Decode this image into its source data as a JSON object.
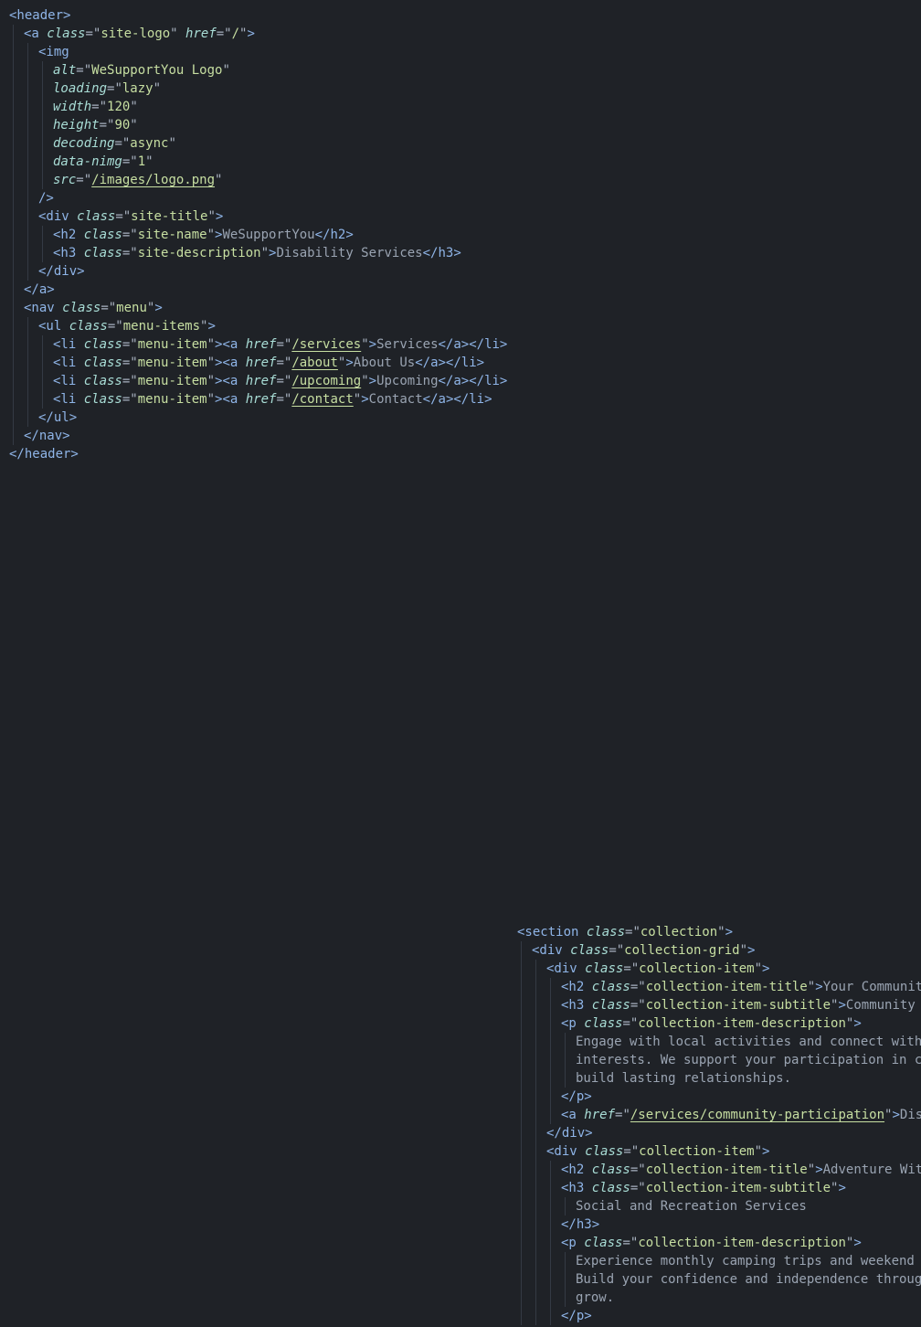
{
  "editor": {
    "theme_background": "#1f2227",
    "colors": {
      "tag": "#8fb5e8",
      "attribute": "#a9ddd6",
      "string": "#c7dfa2",
      "text": "#9aa4b2"
    }
  },
  "header_block": {
    "lines": [
      [
        {
          "k": "t",
          "v": "<header>"
        }
      ],
      [
        {
          "k": "t",
          "v": "<a "
        },
        {
          "k": "attr",
          "v": "class"
        },
        {
          "k": "eq",
          "v": "=\""
        },
        {
          "k": "str",
          "v": "site-logo"
        },
        {
          "k": "eq",
          "v": "\" "
        },
        {
          "k": "attr",
          "v": "href"
        },
        {
          "k": "eq",
          "v": "=\""
        },
        {
          "k": "str",
          "v": "/"
        },
        {
          "k": "eq",
          "v": "\""
        },
        {
          "k": "t",
          "v": ">"
        }
      ],
      [
        {
          "k": "t",
          "v": "<img"
        }
      ],
      [
        {
          "k": "attr",
          "v": "alt"
        },
        {
          "k": "eq",
          "v": "=\""
        },
        {
          "k": "str",
          "v": "WeSupportYou Logo"
        },
        {
          "k": "eq",
          "v": "\""
        }
      ],
      [
        {
          "k": "attr",
          "v": "loading"
        },
        {
          "k": "eq",
          "v": "=\""
        },
        {
          "k": "str",
          "v": "lazy"
        },
        {
          "k": "eq",
          "v": "\""
        }
      ],
      [
        {
          "k": "attr",
          "v": "width"
        },
        {
          "k": "eq",
          "v": "=\""
        },
        {
          "k": "str",
          "v": "120"
        },
        {
          "k": "eq",
          "v": "\""
        }
      ],
      [
        {
          "k": "attr",
          "v": "height"
        },
        {
          "k": "eq",
          "v": "=\""
        },
        {
          "k": "str",
          "v": "90"
        },
        {
          "k": "eq",
          "v": "\""
        }
      ],
      [
        {
          "k": "attr",
          "v": "decoding"
        },
        {
          "k": "eq",
          "v": "=\""
        },
        {
          "k": "str",
          "v": "async"
        },
        {
          "k": "eq",
          "v": "\""
        }
      ],
      [
        {
          "k": "attr",
          "v": "data-nimg"
        },
        {
          "k": "eq",
          "v": "=\""
        },
        {
          "k": "str",
          "v": "1"
        },
        {
          "k": "eq",
          "v": "\""
        }
      ],
      [
        {
          "k": "attr",
          "v": "src"
        },
        {
          "k": "eq",
          "v": "=\""
        },
        {
          "k": "link",
          "v": "/images/logo.png"
        },
        {
          "k": "eq",
          "v": "\""
        }
      ],
      [
        {
          "k": "t",
          "v": "/>"
        }
      ],
      [
        {
          "k": "t",
          "v": "<div "
        },
        {
          "k": "attr",
          "v": "class"
        },
        {
          "k": "eq",
          "v": "=\""
        },
        {
          "k": "str",
          "v": "site-title"
        },
        {
          "k": "eq",
          "v": "\""
        },
        {
          "k": "t",
          "v": ">"
        }
      ],
      [
        {
          "k": "t",
          "v": "<h2 "
        },
        {
          "k": "attr",
          "v": "class"
        },
        {
          "k": "eq",
          "v": "=\""
        },
        {
          "k": "str",
          "v": "site-name"
        },
        {
          "k": "eq",
          "v": "\""
        },
        {
          "k": "t",
          "v": ">"
        },
        {
          "k": "text",
          "v": "WeSupportYou"
        },
        {
          "k": "t",
          "v": "</h2>"
        }
      ],
      [
        {
          "k": "t",
          "v": "<h3 "
        },
        {
          "k": "attr",
          "v": "class"
        },
        {
          "k": "eq",
          "v": "=\""
        },
        {
          "k": "str",
          "v": "site-description"
        },
        {
          "k": "eq",
          "v": "\""
        },
        {
          "k": "t",
          "v": ">"
        },
        {
          "k": "text",
          "v": "Disability Services"
        },
        {
          "k": "t",
          "v": "</h3>"
        }
      ],
      [
        {
          "k": "t",
          "v": "</div>"
        }
      ],
      [
        {
          "k": "t",
          "v": "</a>"
        }
      ],
      [
        {
          "k": "t",
          "v": "<nav "
        },
        {
          "k": "attr",
          "v": "class"
        },
        {
          "k": "eq",
          "v": "=\""
        },
        {
          "k": "str",
          "v": "menu"
        },
        {
          "k": "eq",
          "v": "\""
        },
        {
          "k": "t",
          "v": ">"
        }
      ],
      [
        {
          "k": "t",
          "v": "<ul "
        },
        {
          "k": "attr",
          "v": "class"
        },
        {
          "k": "eq",
          "v": "=\""
        },
        {
          "k": "str",
          "v": "menu-items"
        },
        {
          "k": "eq",
          "v": "\""
        },
        {
          "k": "t",
          "v": ">"
        }
      ],
      [
        {
          "k": "t",
          "v": "<li "
        },
        {
          "k": "attr",
          "v": "class"
        },
        {
          "k": "eq",
          "v": "=\""
        },
        {
          "k": "str",
          "v": "menu-item"
        },
        {
          "k": "eq",
          "v": "\""
        },
        {
          "k": "t",
          "v": "><a "
        },
        {
          "k": "attr",
          "v": "href"
        },
        {
          "k": "eq",
          "v": "=\""
        },
        {
          "k": "link",
          "v": "/services"
        },
        {
          "k": "eq",
          "v": "\""
        },
        {
          "k": "t",
          "v": ">"
        },
        {
          "k": "text",
          "v": "Services"
        },
        {
          "k": "t",
          "v": "</a></li>"
        }
      ],
      [
        {
          "k": "t",
          "v": "<li "
        },
        {
          "k": "attr",
          "v": "class"
        },
        {
          "k": "eq",
          "v": "=\""
        },
        {
          "k": "str",
          "v": "menu-item"
        },
        {
          "k": "eq",
          "v": "\""
        },
        {
          "k": "t",
          "v": "><a "
        },
        {
          "k": "attr",
          "v": "href"
        },
        {
          "k": "eq",
          "v": "=\""
        },
        {
          "k": "link",
          "v": "/about"
        },
        {
          "k": "eq",
          "v": "\""
        },
        {
          "k": "t",
          "v": ">"
        },
        {
          "k": "text",
          "v": "About Us"
        },
        {
          "k": "t",
          "v": "</a></li>"
        }
      ],
      [
        {
          "k": "t",
          "v": "<li "
        },
        {
          "k": "attr",
          "v": "class"
        },
        {
          "k": "eq",
          "v": "=\""
        },
        {
          "k": "str",
          "v": "menu-item"
        },
        {
          "k": "eq",
          "v": "\""
        },
        {
          "k": "t",
          "v": "><a "
        },
        {
          "k": "attr",
          "v": "href"
        },
        {
          "k": "eq",
          "v": "=\""
        },
        {
          "k": "link",
          "v": "/upcoming"
        },
        {
          "k": "eq",
          "v": "\""
        },
        {
          "k": "t",
          "v": ">"
        },
        {
          "k": "text",
          "v": "Upcoming"
        },
        {
          "k": "t",
          "v": "</a></li>"
        }
      ],
      [
        {
          "k": "t",
          "v": "<li "
        },
        {
          "k": "attr",
          "v": "class"
        },
        {
          "k": "eq",
          "v": "=\""
        },
        {
          "k": "str",
          "v": "menu-item"
        },
        {
          "k": "eq",
          "v": "\""
        },
        {
          "k": "t",
          "v": "><a "
        },
        {
          "k": "attr",
          "v": "href"
        },
        {
          "k": "eq",
          "v": "=\""
        },
        {
          "k": "link",
          "v": "/contact"
        },
        {
          "k": "eq",
          "v": "\""
        },
        {
          "k": "t",
          "v": ">"
        },
        {
          "k": "text",
          "v": "Contact"
        },
        {
          "k": "t",
          "v": "</a></li>"
        }
      ],
      [
        {
          "k": "t",
          "v": "</ul>"
        }
      ],
      [
        {
          "k": "t",
          "v": "</nav>"
        }
      ],
      [
        {
          "k": "t",
          "v": "</header>"
        }
      ]
    ],
    "indent": [
      0,
      1,
      2,
      3,
      3,
      3,
      3,
      3,
      3,
      3,
      2,
      2,
      3,
      3,
      2,
      1,
      1,
      2,
      3,
      3,
      3,
      3,
      2,
      1,
      0
    ]
  },
  "collection_block": {
    "lines": [
      [
        {
          "k": "t",
          "v": "<section "
        },
        {
          "k": "attr",
          "v": "class"
        },
        {
          "k": "eq",
          "v": "=\""
        },
        {
          "k": "str",
          "v": "collection"
        },
        {
          "k": "eq",
          "v": "\""
        },
        {
          "k": "t",
          "v": ">"
        }
      ],
      [
        {
          "k": "t",
          "v": "<div "
        },
        {
          "k": "attr",
          "v": "class"
        },
        {
          "k": "eq",
          "v": "=\""
        },
        {
          "k": "str",
          "v": "collection-grid"
        },
        {
          "k": "eq",
          "v": "\""
        },
        {
          "k": "t",
          "v": ">"
        }
      ],
      [
        {
          "k": "t",
          "v": "<div "
        },
        {
          "k": "attr",
          "v": "class"
        },
        {
          "k": "eq",
          "v": "=\""
        },
        {
          "k": "str",
          "v": "collection-item"
        },
        {
          "k": "eq",
          "v": "\""
        },
        {
          "k": "t",
          "v": ">"
        }
      ],
      [
        {
          "k": "t",
          "v": "<h2 "
        },
        {
          "k": "attr",
          "v": "class"
        },
        {
          "k": "eq",
          "v": "=\""
        },
        {
          "k": "str",
          "v": "collection-item-title"
        },
        {
          "k": "eq",
          "v": "\""
        },
        {
          "k": "t",
          "v": ">"
        },
        {
          "k": "text",
          "v": "Your Community"
        }
      ],
      [
        {
          "k": "t",
          "v": "<h3 "
        },
        {
          "k": "attr",
          "v": "class"
        },
        {
          "k": "eq",
          "v": "=\""
        },
        {
          "k": "str",
          "v": "collection-item-subtitle"
        },
        {
          "k": "eq",
          "v": "\""
        },
        {
          "k": "t",
          "v": ">"
        },
        {
          "k": "text",
          "v": "Community Pa"
        }
      ],
      [
        {
          "k": "t",
          "v": "<p "
        },
        {
          "k": "attr",
          "v": "class"
        },
        {
          "k": "eq",
          "v": "=\""
        },
        {
          "k": "str",
          "v": "collection-item-description"
        },
        {
          "k": "eq",
          "v": "\""
        },
        {
          "k": "t",
          "v": ">"
        }
      ],
      [
        {
          "k": "text",
          "v": "Engage with local activities and connect with p"
        }
      ],
      [
        {
          "k": "text",
          "v": "interests. We support your participation in com"
        }
      ],
      [
        {
          "k": "text",
          "v": "build lasting relationships."
        }
      ],
      [
        {
          "k": "t",
          "v": "</p>"
        }
      ],
      [
        {
          "k": "t",
          "v": "<a "
        },
        {
          "k": "attr",
          "v": "href"
        },
        {
          "k": "eq",
          "v": "=\""
        },
        {
          "k": "link",
          "v": "/services/community-participation"
        },
        {
          "k": "eq",
          "v": "\""
        },
        {
          "k": "t",
          "v": ">"
        },
        {
          "k": "text",
          "v": "Disco"
        }
      ],
      [
        {
          "k": "t",
          "v": "</div>"
        }
      ],
      [
        {
          "k": "t",
          "v": "<div "
        },
        {
          "k": "attr",
          "v": "class"
        },
        {
          "k": "eq",
          "v": "=\""
        },
        {
          "k": "str",
          "v": "collection-item"
        },
        {
          "k": "eq",
          "v": "\""
        },
        {
          "k": "t",
          "v": ">"
        }
      ],
      [
        {
          "k": "t",
          "v": "<h2 "
        },
        {
          "k": "attr",
          "v": "class"
        },
        {
          "k": "eq",
          "v": "=\""
        },
        {
          "k": "str",
          "v": "collection-item-title"
        },
        {
          "k": "eq",
          "v": "\""
        },
        {
          "k": "t",
          "v": ">"
        },
        {
          "k": "text",
          "v": "Adventure Witho"
        }
      ],
      [
        {
          "k": "t",
          "v": "<h3 "
        },
        {
          "k": "attr",
          "v": "class"
        },
        {
          "k": "eq",
          "v": "=\""
        },
        {
          "k": "str",
          "v": "collection-item-subtitle"
        },
        {
          "k": "eq",
          "v": "\""
        },
        {
          "k": "t",
          "v": ">"
        }
      ],
      [
        {
          "k": "text",
          "v": "Social and Recreation Services"
        }
      ],
      [
        {
          "k": "t",
          "v": "</h3>"
        }
      ],
      [
        {
          "k": "t",
          "v": "<p "
        },
        {
          "k": "attr",
          "v": "class"
        },
        {
          "k": "eq",
          "v": "=\""
        },
        {
          "k": "str",
          "v": "collection-item-description"
        },
        {
          "k": "eq",
          "v": "\""
        },
        {
          "k": "t",
          "v": ">"
        }
      ],
      [
        {
          "k": "text",
          "v": "Experience monthly camping trips and weekend ge"
        }
      ],
      [
        {
          "k": "text",
          "v": "Build your confidence and independence through "
        }
      ],
      [
        {
          "k": "text",
          "v": "grow."
        }
      ],
      [
        {
          "k": "t",
          "v": "</p>"
        }
      ]
    ],
    "indent": [
      0,
      1,
      2,
      3,
      3,
      3,
      4,
      4,
      4,
      3,
      3,
      2,
      2,
      3,
      3,
      4,
      3,
      3,
      4,
      4,
      4,
      3
    ]
  }
}
